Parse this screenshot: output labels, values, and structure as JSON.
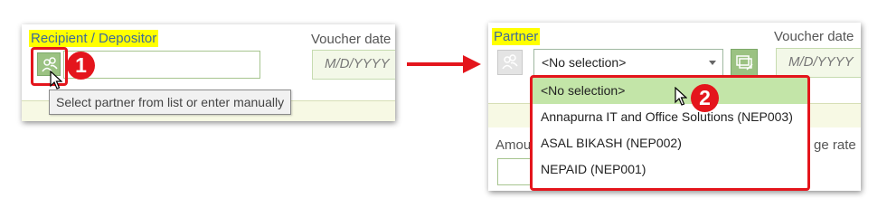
{
  "left": {
    "label_recipient": "Recipient / Depositor",
    "label_voucher_date": "Voucher date",
    "date_placeholder": "M/D/YYYY",
    "tooltip": "Select partner from list or enter manually",
    "step_badge": "1"
  },
  "right": {
    "label_partner": "Partner",
    "label_voucher_date": "Voucher date",
    "date_placeholder": "M/D/YYYY",
    "select_value": "<No selection>",
    "dropdown_options": [
      "<No selection>",
      "Annapurna IT and Office Solutions (NEP003)",
      "ASAL BIKASH (NEP002)",
      "NEPAID (NEP001)"
    ],
    "partial_amount_label": "Amou",
    "partial_rate_label": "ge rate",
    "step_badge": "2"
  },
  "colors": {
    "highlight": "#ffff00",
    "label_blue": "#3d6a99",
    "button_green": "#9bc282",
    "selected_row": "#c3e5a8",
    "annotation_red": "#e4151c",
    "arrow_red": "#e4151c"
  }
}
